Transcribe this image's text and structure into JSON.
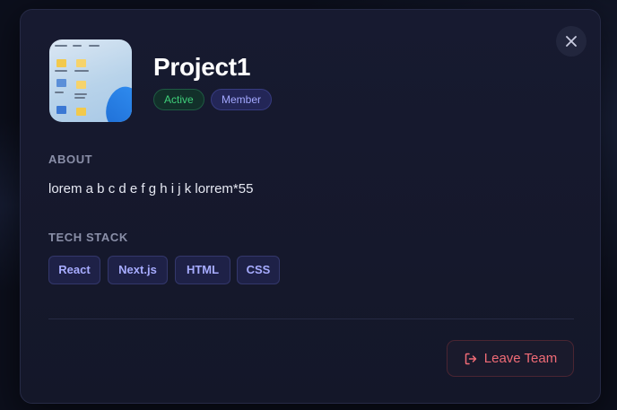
{
  "project": {
    "title": "Project1",
    "badges": {
      "status": "Active",
      "role": "Member"
    }
  },
  "about": {
    "heading": "ABOUT",
    "text": "lorem a b c d e f g h i j k lorrem*55"
  },
  "tech_stack": {
    "heading": "TECH STACK",
    "items": [
      "React",
      "Next.js",
      "HTML",
      "CSS"
    ]
  },
  "actions": {
    "leave_label": "Leave Team"
  },
  "icons": {
    "close": "close-icon",
    "leave": "logout-icon",
    "thumbnail": "project-thumbnail"
  },
  "colors": {
    "status_active": "#3fd07a",
    "role_member": "#a3a8ff",
    "danger": "#f06b76",
    "accent_chip": "#a7acff"
  }
}
